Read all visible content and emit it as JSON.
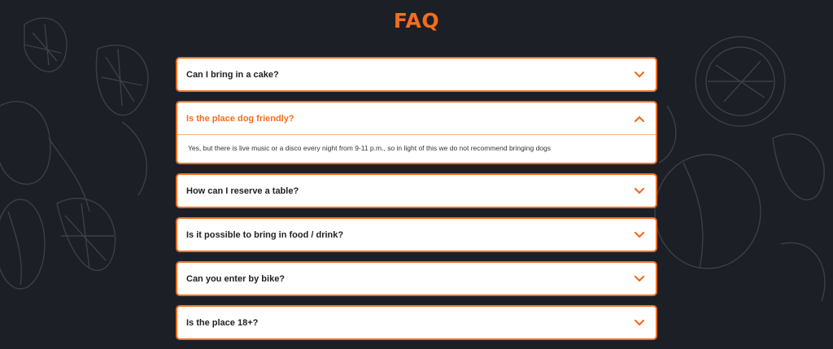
{
  "page": {
    "title": "FAQ"
  },
  "colors": {
    "accent": "#f26e1d",
    "background": "#1d1f26",
    "card": "#ffffff"
  },
  "faq": [
    {
      "question": "Can I bring in a cake?",
      "open": false,
      "answer": ""
    },
    {
      "question": "Is the place dog friendly?",
      "open": true,
      "answer": "Yes, but there is live music or a disco every night from 9-11 p.m., so in light of this we do not recommend bringing dogs"
    },
    {
      "question": "How can I reserve a table?",
      "open": false,
      "answer": ""
    },
    {
      "question": "Is it possible to bring in food / drink?",
      "open": false,
      "answer": ""
    },
    {
      "question": "Can you enter by bike?",
      "open": false,
      "answer": ""
    },
    {
      "question": "Is the place 18+?",
      "open": false,
      "answer": ""
    }
  ]
}
